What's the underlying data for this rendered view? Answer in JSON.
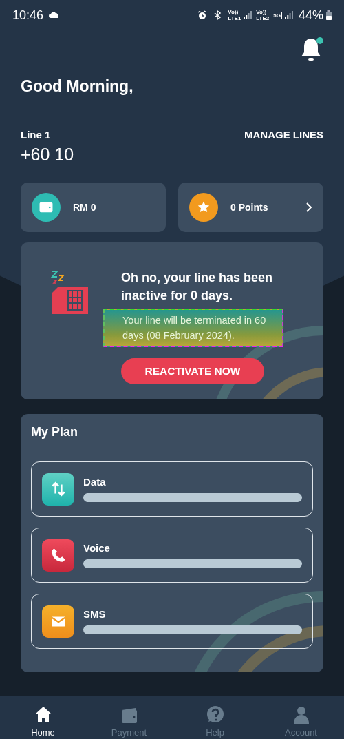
{
  "status_bar": {
    "time": "10:46",
    "networks": [
      {
        "top": "Vo))",
        "bottom": "LTE1"
      },
      {
        "top": "Vo))",
        "bottom": "LTE2",
        "badge": "5G"
      }
    ],
    "battery": "44%"
  },
  "header": {
    "notification_unread": true,
    "greeting": "Good Morning,"
  },
  "line": {
    "label": "Line 1",
    "number": "+60 10",
    "manage": "MANAGE LINES"
  },
  "balance": {
    "amount": "RM 0"
  },
  "points": {
    "label": "0 Points"
  },
  "alert": {
    "title": "Oh no, your line has been inactive for 0 days.",
    "message": "Your line will be terminated in 60 days (08 February 2024).",
    "button": "REACTIVATE NOW"
  },
  "plan": {
    "title": "My Plan",
    "items": [
      {
        "kind": "data",
        "label": "Data"
      },
      {
        "kind": "voice",
        "label": "Voice"
      },
      {
        "kind": "sms",
        "label": "SMS"
      }
    ]
  },
  "nav": [
    {
      "kind": "home",
      "label": "Home",
      "selected": true
    },
    {
      "kind": "payment",
      "label": "Payment",
      "selected": false
    },
    {
      "kind": "help",
      "label": "Help",
      "selected": false
    },
    {
      "kind": "account",
      "label": "Account",
      "selected": false
    }
  ]
}
